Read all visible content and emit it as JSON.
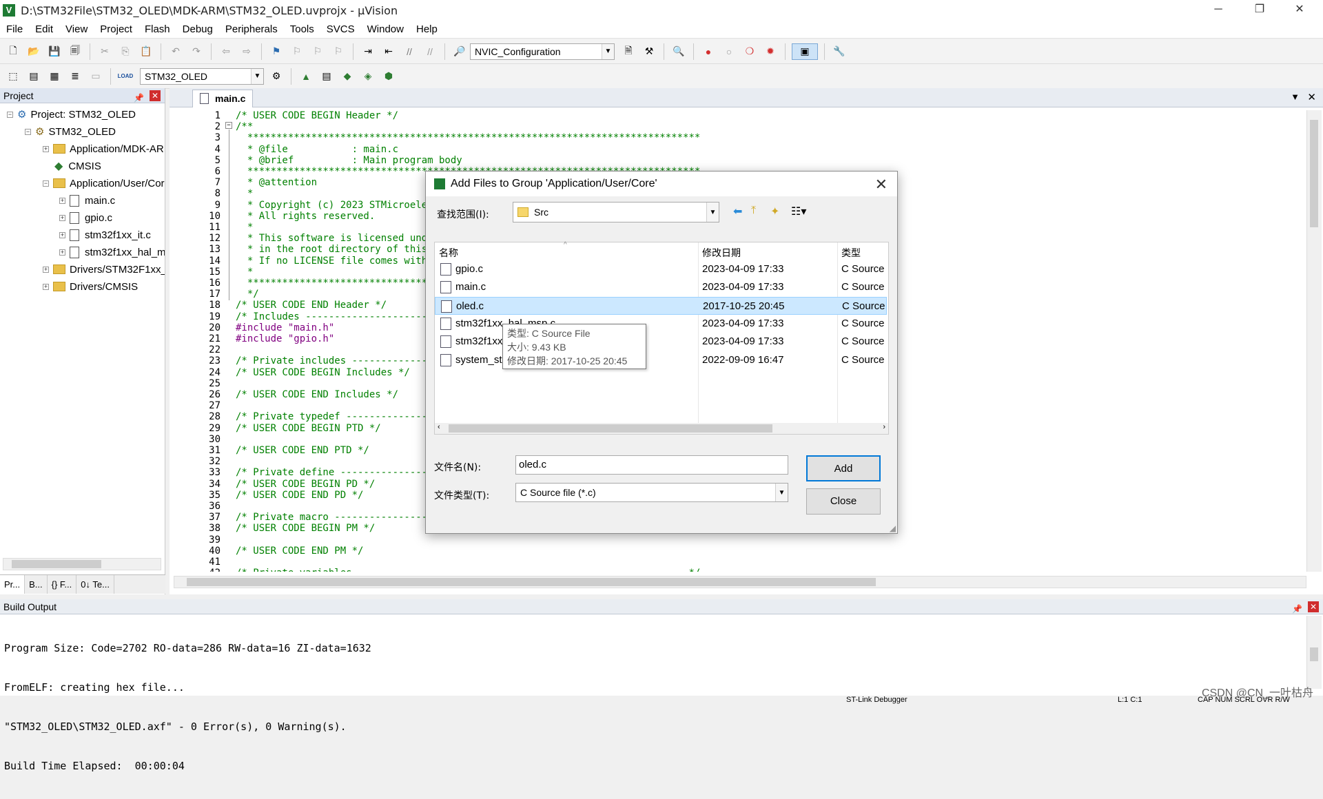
{
  "window": {
    "title": "D:\\STM32File\\STM32_OLED\\MDK-ARM\\STM32_OLED.uvprojx - µVision",
    "app_icon": "V"
  },
  "menu": [
    "File",
    "Edit",
    "View",
    "Project",
    "Flash",
    "Debug",
    "Peripherals",
    "Tools",
    "SVCS",
    "Window",
    "Help"
  ],
  "toolbar1": {
    "target_combo": "NVIC_Configuration"
  },
  "toolbar2": {
    "target_combo": "STM32_OLED",
    "load_label": "LOAD"
  },
  "project_panel": {
    "title": "Project",
    "tree": [
      {
        "label": "Project: STM32_OLED",
        "expander": "−"
      },
      {
        "label": "STM32_OLED",
        "expander": "−"
      },
      {
        "label": "Application/MDK-ARM",
        "expander": "+"
      },
      {
        "label": "CMSIS",
        "expander": ""
      },
      {
        "label": "Application/User/Core",
        "expander": "−"
      },
      {
        "label": "main.c",
        "expander": "+"
      },
      {
        "label": "gpio.c",
        "expander": "+"
      },
      {
        "label": "stm32f1xx_it.c",
        "expander": "+"
      },
      {
        "label": "stm32f1xx_hal_msp.c",
        "expander": "+"
      },
      {
        "label": "Drivers/STM32F1xx_HAL_Driver",
        "expander": "+"
      },
      {
        "label": "Drivers/CMSIS",
        "expander": "+"
      }
    ],
    "tabs": [
      "Pr...",
      "B...",
      "{} F...",
      "0↓ Te..."
    ]
  },
  "editor": {
    "tab": "main.c",
    "lines": [
      {
        "n": "1",
        "t": "/* USER CODE BEGIN Header */",
        "c": "cm"
      },
      {
        "n": "2",
        "t": "/**",
        "c": "cm"
      },
      {
        "n": "3",
        "t": "  ******************************************************************************",
        "c": "cm"
      },
      {
        "n": "4",
        "t": "  * @file           : main.c",
        "c": "cm"
      },
      {
        "n": "5",
        "t": "  * @brief          : Main program body",
        "c": "cm"
      },
      {
        "n": "6",
        "t": "  ******************************************************************************",
        "c": "cm"
      },
      {
        "n": "7",
        "t": "  * @attention",
        "c": "cm"
      },
      {
        "n": "8",
        "t": "  *",
        "c": "cm"
      },
      {
        "n": "9",
        "t": "  * Copyright (c) 2023 STMicroelec",
        "c": "cm"
      },
      {
        "n": "10",
        "t": "  * All rights reserved.",
        "c": "cm"
      },
      {
        "n": "11",
        "t": "  *",
        "c": "cm"
      },
      {
        "n": "12",
        "t": "  * This software is licensed unde",
        "c": "cm"
      },
      {
        "n": "13",
        "t": "  * in the root directory of this",
        "c": "cm"
      },
      {
        "n": "14",
        "t": "  * If no LICENSE file comes with",
        "c": "cm"
      },
      {
        "n": "15",
        "t": "  *",
        "c": "cm"
      },
      {
        "n": "16",
        "t": "  ******************************************************************************",
        "c": "cm"
      },
      {
        "n": "17",
        "t": "  */",
        "c": "cm"
      },
      {
        "n": "18",
        "t": "/* USER CODE END Header */",
        "c": "cm"
      },
      {
        "n": "19",
        "t": "/* Includes ------------------------------",
        "c": "cm"
      },
      {
        "n": "20",
        "t": "#include \"main.h\"",
        "c": "pp"
      },
      {
        "n": "21",
        "t": "#include \"gpio.h\"",
        "c": "pp"
      },
      {
        "n": "22",
        "t": "",
        "c": "cm"
      },
      {
        "n": "23",
        "t": "/* Private includes ----------------------",
        "c": "cm"
      },
      {
        "n": "24",
        "t": "/* USER CODE BEGIN Includes */",
        "c": "cm"
      },
      {
        "n": "25",
        "t": "",
        "c": "cm"
      },
      {
        "n": "26",
        "t": "/* USER CODE END Includes */",
        "c": "cm"
      },
      {
        "n": "27",
        "t": "",
        "c": "cm"
      },
      {
        "n": "28",
        "t": "/* Private typedef -----------------------",
        "c": "cm"
      },
      {
        "n": "29",
        "t": "/* USER CODE BEGIN PTD */",
        "c": "cm"
      },
      {
        "n": "30",
        "t": "",
        "c": "cm"
      },
      {
        "n": "31",
        "t": "/* USER CODE END PTD */",
        "c": "cm"
      },
      {
        "n": "32",
        "t": "",
        "c": "cm"
      },
      {
        "n": "33",
        "t": "/* Private define ------------------------",
        "c": "cm"
      },
      {
        "n": "34",
        "t": "/* USER CODE BEGIN PD */",
        "c": "cm"
      },
      {
        "n": "35",
        "t": "/* USER CODE END PD */",
        "c": "cm"
      },
      {
        "n": "36",
        "t": "",
        "c": "cm"
      },
      {
        "n": "37",
        "t": "/* Private macro -------------------------",
        "c": "cm"
      },
      {
        "n": "38",
        "t": "/* USER CODE BEGIN PM */",
        "c": "cm"
      },
      {
        "n": "39",
        "t": "",
        "c": "cm"
      },
      {
        "n": "40",
        "t": "/* USER CODE END PM */",
        "c": "cm"
      },
      {
        "n": "41",
        "t": "",
        "c": "cm"
      },
      {
        "n": "42",
        "t": "/* Private variables ---------------------------------------------------------*/",
        "c": "cm"
      }
    ]
  },
  "dialog": {
    "title": "Add Files to Group 'Application/User/Core'",
    "look_in_label": "查找范围(I):",
    "look_in_value": "Src",
    "columns": {
      "name": "名称",
      "date": "修改日期",
      "type": "类型"
    },
    "files": [
      {
        "name": "gpio.c",
        "date": "2023-04-09 17:33",
        "type": "C Source"
      },
      {
        "name": "main.c",
        "date": "2023-04-09 17:33",
        "type": "C Source"
      },
      {
        "name": "oled.c",
        "date": "2017-10-25 20:45",
        "type": "C Source"
      },
      {
        "name": "stm32f1xx_hal_msp.c",
        "date": "2023-04-09 17:33",
        "type": "C Source"
      },
      {
        "name": "stm32f1xx_it.c",
        "date": "2023-04-09 17:33",
        "type": "C Source"
      },
      {
        "name": "system_stm32f1xx.c",
        "date": "2022-09-09 16:47",
        "type": "C Source"
      }
    ],
    "selected_file": "oled.c",
    "tooltip": {
      "type": "类型: C Source File",
      "size": "大小: 9.43 KB",
      "date": "修改日期: 2017-10-25 20:45"
    },
    "filename_label": "文件名(N):",
    "filename_value": "oled.c",
    "filetype_label": "文件类型(T):",
    "filetype_value": "C Source file (*.c)",
    "add_button": "Add",
    "close_button": "Close"
  },
  "build_output": {
    "title": "Build Output",
    "lines": [
      "Program Size: Code=2702 RO-data=286 RW-data=16 ZI-data=1632",
      "FromELF: creating hex file...",
      "\"STM32_OLED\\STM32_OLED.axf\" - 0 Error(s), 0 Warning(s).",
      "Build Time Elapsed:  00:00:04"
    ]
  },
  "status_bar": {
    "debugger": "ST-Link Debugger",
    "position": "L:1 C:1",
    "flags": "CAP NUM SCRL OVR R/W"
  },
  "watermark": "CSDN @CN_一叶枯舟",
  "colors": {
    "comment": "#008000",
    "preprocessor": "#800080",
    "selection": "#cce8ff",
    "accent": "#0078d7"
  }
}
